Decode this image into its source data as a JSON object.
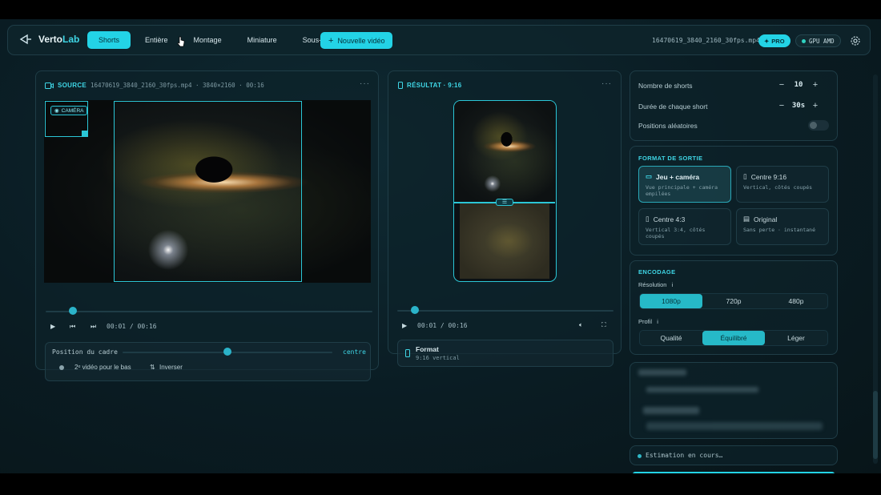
{
  "app": {
    "logo_main": "Verto",
    "logo_accent": "Lab"
  },
  "tabs": [
    {
      "label": "Shorts",
      "active": true
    },
    {
      "label": "Entière",
      "active": false
    },
    {
      "label": "Montage",
      "active": false
    },
    {
      "label": "Miniature",
      "active": false
    },
    {
      "label": "Sous-titres",
      "active": false
    }
  ],
  "header": {
    "new_video_label": "Nouvelle vidéo",
    "filename": "16470619_3840_2160_30fps.mp4",
    "pro_label": "PRO",
    "gpu_label": "GPU AMD"
  },
  "source": {
    "title": "SOURCE",
    "meta": "16470619_3840_2160_30fps.mp4 · 3840×2160 · 00:16",
    "camera_badge": "CAMÉRA",
    "time": "00:01 / 00:16",
    "progress": 0.083,
    "frame_position_label": "Position du cadre",
    "frame_position_value": "centre",
    "frame_position": 0.5,
    "second_video_label": "2ᵉ vidéo pour le bas",
    "invert_label": "Inverser"
  },
  "result": {
    "title": "RÉSULTAT · 9:16",
    "time": "00:01 / 00:16",
    "progress": 0.083,
    "format_title": "Format",
    "format_desc": "9:16 vertical"
  },
  "settings": {
    "shorts_count_label": "Nombre de shorts",
    "shorts_count": "10",
    "duration_label": "Durée de chaque short",
    "duration": "30s",
    "random_positions_label": "Positions aléatoires",
    "random_positions": false
  },
  "output_format": {
    "title": "FORMAT DE SORTIE",
    "options": [
      {
        "title": "Jeu + caméra",
        "desc": "Vue principale + caméra empilées",
        "active": true,
        "icon": "monitor-icon"
      },
      {
        "title": "Centre 9:16",
        "desc": "Vertical, côtés coupés",
        "active": false,
        "icon": "phone-crop-icon"
      },
      {
        "title": "Centre 4:3",
        "desc": "Vertical 3:4, côtés coupés",
        "active": false,
        "icon": "phone-icon"
      },
      {
        "title": "Original",
        "desc": "Sans perte · instantané",
        "active": false,
        "icon": "calendar-icon"
      }
    ]
  },
  "encoding": {
    "title": "ENCODAGE",
    "resolution_label": "Résolution",
    "resolutions": [
      "1080p",
      "720p",
      "480p"
    ],
    "resolution_selected": "1080p",
    "profile_label": "Profil",
    "profiles": [
      "Qualité",
      "Équilibré",
      "Léger"
    ],
    "profile_selected": "Équilibré"
  },
  "estimate": {
    "label": "Estimation en cours…"
  },
  "colors": {
    "accent": "#23d3e6",
    "background": "#0a1c23",
    "panel_border": "#1f3d47"
  }
}
